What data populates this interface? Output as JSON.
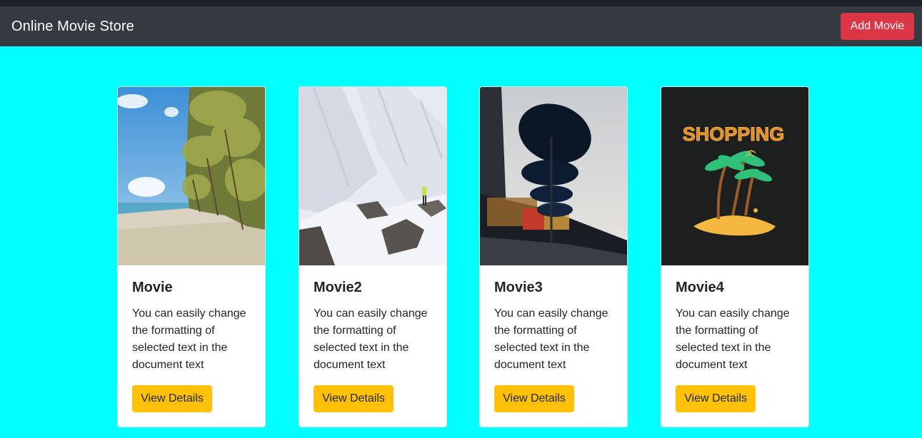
{
  "navbar": {
    "brand": "Online Movie Store",
    "add_button": "Add Movie"
  },
  "movies": [
    {
      "title": "Movie",
      "description": "You can easily change the formatting of selected text in the document text",
      "button": "View Details",
      "image_icon": "beach-palm-image"
    },
    {
      "title": "Movie2",
      "description": "You can easily change the formatting of selected text in the document text",
      "button": "View Details",
      "image_icon": "snow-mountain-image"
    },
    {
      "title": "Movie3",
      "description": "You can easily change the formatting of selected text in the document text",
      "button": "View Details",
      "image_icon": "umbrella-image"
    },
    {
      "title": "Movie4",
      "description": "You can easily change the formatting of selected text in the document text",
      "button": "View Details",
      "image_icon": "shopping-palm-logo-image",
      "image_text": "SHOPPING"
    }
  ],
  "colors": {
    "page_bg": "#00ffff",
    "navbar_bg": "#343a40",
    "add_button_bg": "#dc3545",
    "view_button_bg": "#ffc107"
  }
}
